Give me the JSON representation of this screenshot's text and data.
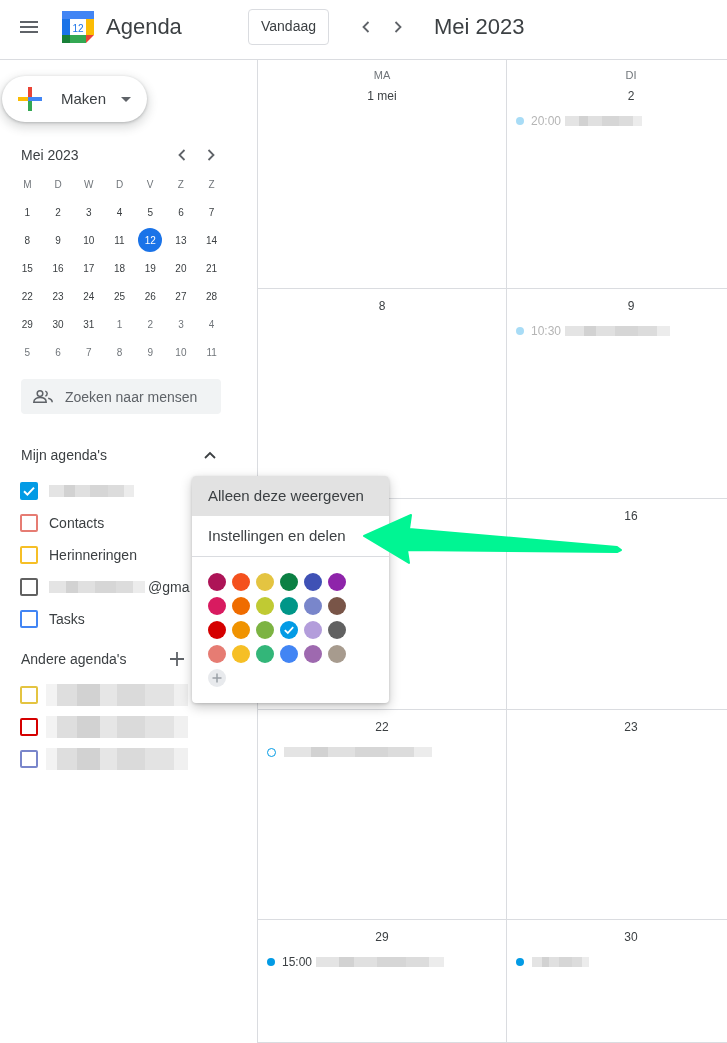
{
  "topbar": {
    "logo_day": "12",
    "app_name": "Agenda",
    "today_button": "Vandaag",
    "period_title": "Mei 2023"
  },
  "sidebar": {
    "create_button": "Maken",
    "mini_calendar": {
      "title": "Mei 2023",
      "weekdays": [
        "M",
        "D",
        "W",
        "D",
        "V",
        "Z",
        "Z"
      ],
      "weeks": [
        [
          {
            "day": "1",
            "muted": false,
            "selected": false
          },
          {
            "day": "2",
            "muted": false,
            "selected": false
          },
          {
            "day": "3",
            "muted": false,
            "selected": false
          },
          {
            "day": "4",
            "muted": false,
            "selected": false
          },
          {
            "day": "5",
            "muted": false,
            "selected": false
          },
          {
            "day": "6",
            "muted": false,
            "selected": false
          },
          {
            "day": "7",
            "muted": false,
            "selected": false
          }
        ],
        [
          {
            "day": "8",
            "muted": false,
            "selected": false
          },
          {
            "day": "9",
            "muted": false,
            "selected": false
          },
          {
            "day": "10",
            "muted": false,
            "selected": false
          },
          {
            "day": "11",
            "muted": false,
            "selected": false
          },
          {
            "day": "12",
            "muted": false,
            "selected": true
          },
          {
            "day": "13",
            "muted": false,
            "selected": false
          },
          {
            "day": "14",
            "muted": false,
            "selected": false
          }
        ],
        [
          {
            "day": "15",
            "muted": false,
            "selected": false
          },
          {
            "day": "16",
            "muted": false,
            "selected": false
          },
          {
            "day": "17",
            "muted": false,
            "selected": false
          },
          {
            "day": "18",
            "muted": false,
            "selected": false
          },
          {
            "day": "19",
            "muted": false,
            "selected": false
          },
          {
            "day": "20",
            "muted": false,
            "selected": false
          },
          {
            "day": "21",
            "muted": false,
            "selected": false
          }
        ],
        [
          {
            "day": "22",
            "muted": false,
            "selected": false
          },
          {
            "day": "23",
            "muted": false,
            "selected": false
          },
          {
            "day": "24",
            "muted": false,
            "selected": false
          },
          {
            "day": "25",
            "muted": false,
            "selected": false
          },
          {
            "day": "26",
            "muted": false,
            "selected": false
          },
          {
            "day": "27",
            "muted": false,
            "selected": false
          },
          {
            "day": "28",
            "muted": false,
            "selected": false
          }
        ],
        [
          {
            "day": "29",
            "muted": false,
            "selected": false
          },
          {
            "day": "30",
            "muted": false,
            "selected": false
          },
          {
            "day": "31",
            "muted": false,
            "selected": false
          },
          {
            "day": "1",
            "muted": true,
            "selected": false
          },
          {
            "day": "2",
            "muted": true,
            "selected": false
          },
          {
            "day": "3",
            "muted": true,
            "selected": false
          },
          {
            "day": "4",
            "muted": true,
            "selected": false
          }
        ],
        [
          {
            "day": "5",
            "muted": true,
            "selected": false
          },
          {
            "day": "6",
            "muted": true,
            "selected": false
          },
          {
            "day": "7",
            "muted": true,
            "selected": false
          },
          {
            "day": "8",
            "muted": true,
            "selected": false
          },
          {
            "day": "9",
            "muted": true,
            "selected": false
          },
          {
            "day": "10",
            "muted": true,
            "selected": false
          },
          {
            "day": "11",
            "muted": true,
            "selected": false
          }
        ]
      ]
    },
    "people_search": {
      "placeholder": "Zoeken naar mensen"
    },
    "my_calendars": {
      "title": "Mijn agenda's",
      "expanded": true,
      "items": [
        {
          "redacted": true,
          "checked": true,
          "color": "#039be5"
        },
        {
          "label": "Contacts",
          "checked": false,
          "color": "#e67c73"
        },
        {
          "label": "Herinneringen",
          "checked": false,
          "color": "#f6bf26"
        },
        {
          "redacted": true,
          "label": "@gma",
          "checked": false,
          "color": "#616161"
        },
        {
          "label": "Tasks",
          "checked": false,
          "color": "#4285f4"
        }
      ]
    },
    "other_calendars": {
      "title": "Andere agenda's",
      "items": [
        {
          "redacted": true,
          "checked": false,
          "color": "#e4c441"
        },
        {
          "redacted": true,
          "checked": false,
          "color": "#d50000"
        },
        {
          "redacted": true,
          "checked": false,
          "color": "#7986cb"
        }
      ]
    }
  },
  "month_grid": {
    "weekdays": [
      "MA",
      "DI"
    ],
    "weeks": [
      {
        "monday": {
          "date": "1 mei"
        },
        "tuesday": {
          "date": "2",
          "events": [
            {
              "kind": "timed",
              "time": "20:00",
              "past": true,
              "redacted": true
            }
          ]
        }
      },
      {
        "monday": {
          "date": "8"
        },
        "tuesday": {
          "date": "9",
          "events": [
            {
              "kind": "timed",
              "time": "10:30",
              "past": true,
              "redacted": true
            }
          ]
        }
      },
      {
        "tuesday": {
          "date": "16"
        }
      },
      {
        "monday": {
          "date": "22",
          "events": [
            {
              "kind": "pending",
              "past": false,
              "redacted": true
            }
          ]
        },
        "tuesday": {
          "date": "23"
        }
      },
      {
        "monday": {
          "date": "29",
          "events": [
            {
              "kind": "timed",
              "time": "15:00",
              "past": false,
              "redacted": true
            }
          ]
        },
        "tuesday": {
          "date": "30",
          "events": [
            {
              "kind": "timed",
              "past": false,
              "redacted": true
            }
          ]
        }
      }
    ]
  },
  "context_menu": {
    "items": [
      {
        "label": "Alleen deze weergeven",
        "highlighted": true
      },
      {
        "label": "Instellingen en delen",
        "highlighted": false
      }
    ],
    "colors": [
      {
        "color": "#ad1457",
        "selected": false
      },
      {
        "color": "#f4511e",
        "selected": false
      },
      {
        "color": "#e4c441",
        "selected": false
      },
      {
        "color": "#0b8043",
        "selected": false
      },
      {
        "color": "#3f51b5",
        "selected": false
      },
      {
        "color": "#8e24aa",
        "selected": false
      },
      {
        "color": "#d81b60",
        "selected": false
      },
      {
        "color": "#ef6c00",
        "selected": false
      },
      {
        "color": "#c0ca33",
        "selected": false
      },
      {
        "color": "#009688",
        "selected": false
      },
      {
        "color": "#7986cb",
        "selected": false
      },
      {
        "color": "#795548",
        "selected": false
      },
      {
        "color": "#d50000",
        "selected": false
      },
      {
        "color": "#f09300",
        "selected": false
      },
      {
        "color": "#7cb342",
        "selected": false
      },
      {
        "color": "#039be5",
        "selected": true
      },
      {
        "color": "#b39ddb",
        "selected": false
      },
      {
        "color": "#616161",
        "selected": false
      },
      {
        "color": "#e67c73",
        "selected": false
      },
      {
        "color": "#f6bf26",
        "selected": false
      },
      {
        "color": "#33b679",
        "selected": false
      },
      {
        "color": "#4285f4",
        "selected": false
      },
      {
        "color": "#9e69af",
        "selected": false
      },
      {
        "color": "#a79b8e",
        "selected": false
      }
    ]
  },
  "annotations": [
    {
      "kind": "arrow"
    }
  ]
}
